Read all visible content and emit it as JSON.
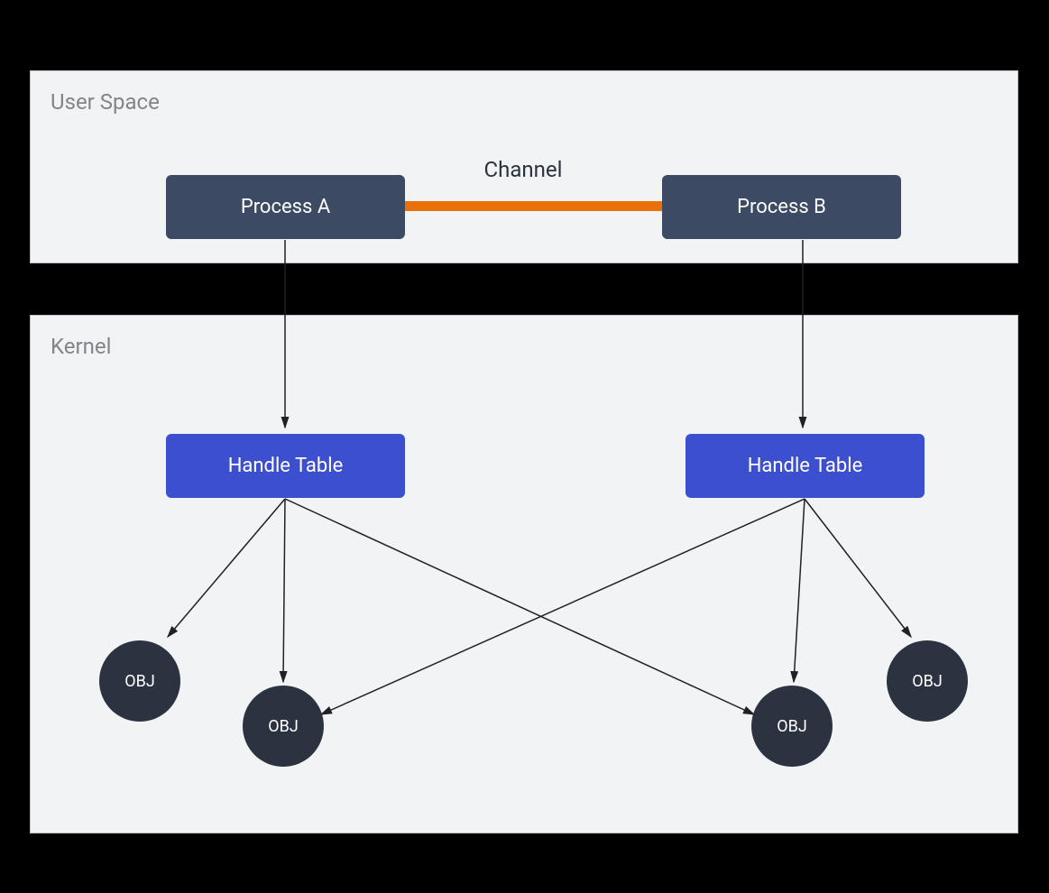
{
  "panels": {
    "user_space": {
      "title": "User Space"
    },
    "kernel": {
      "title": "Kernel"
    }
  },
  "processes": {
    "a": {
      "label": "Process A"
    },
    "b": {
      "label": "Process B"
    }
  },
  "channel": {
    "label": "Channel"
  },
  "handle_tables": {
    "a": {
      "label": "Handle Table"
    },
    "b": {
      "label": "Handle Table"
    }
  },
  "objects": {
    "o1": {
      "label": "OBJ"
    },
    "o2": {
      "label": "OBJ"
    },
    "o3": {
      "label": "OBJ"
    },
    "o4": {
      "label": "OBJ"
    }
  },
  "colors": {
    "navy": "#3c4a63",
    "blue": "#3b4fcf",
    "channel": "#e8710a",
    "panel_bg": "#f1f3f4",
    "panel_border": "#bdc1c6",
    "circle": "#2b3340"
  }
}
